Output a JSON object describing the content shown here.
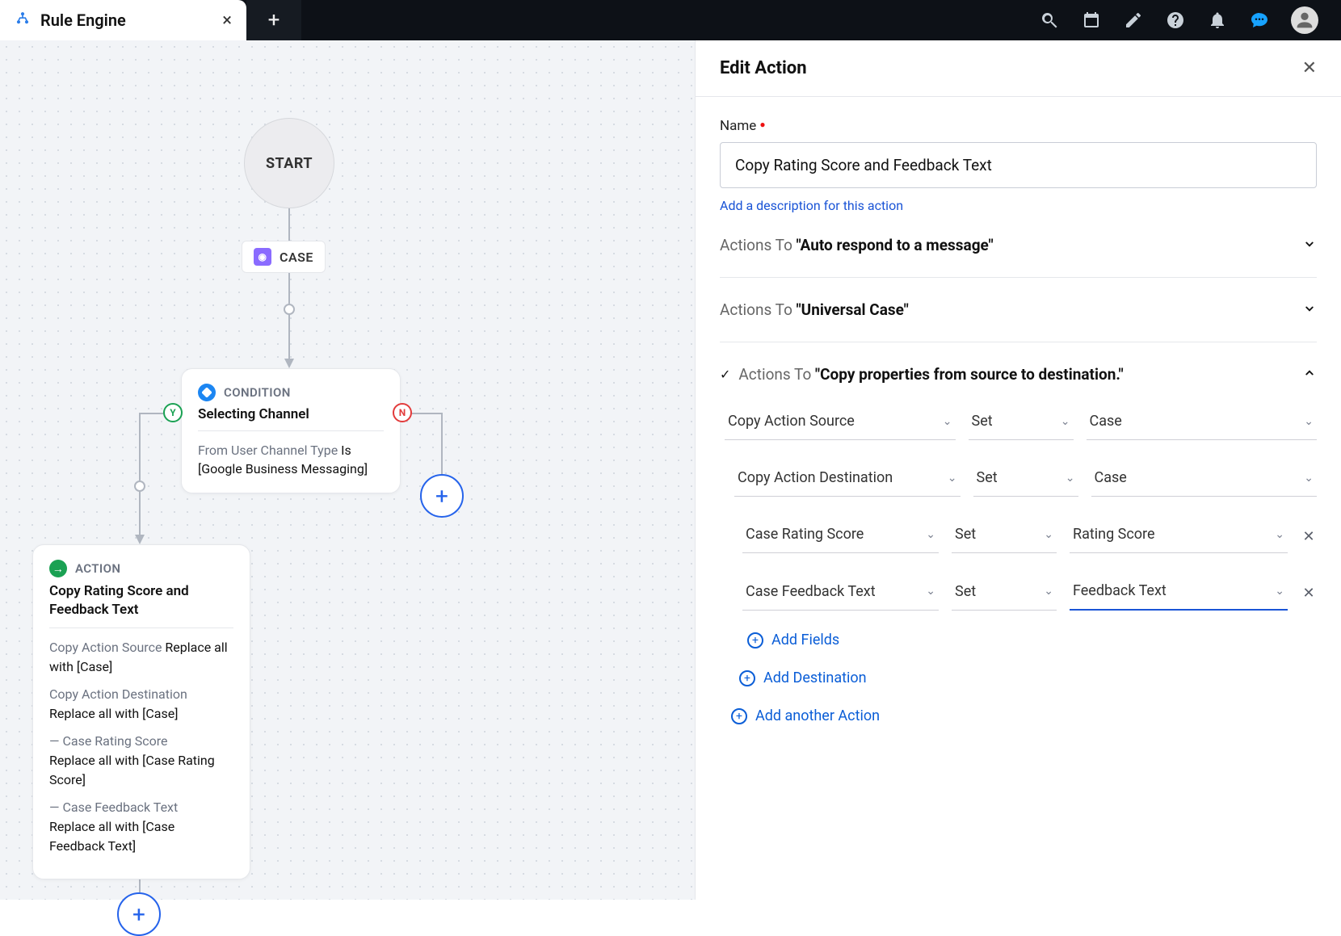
{
  "tab": {
    "title": "Rule Engine"
  },
  "canvas": {
    "start": "START",
    "case_chip": "CASE",
    "condition": {
      "label": "CONDITION",
      "title": "Selecting Channel",
      "text_prefix": "From User Channel Type ",
      "text_bold": "Is [Google Business Messaging]"
    },
    "action": {
      "label": "ACTION",
      "title": "Copy Rating Score and Feedback Text",
      "lines": [
        {
          "muted": "Copy Action Source ",
          "text": "Replace all with [Case]"
        },
        {
          "muted": "Copy Action Destination",
          "text": "Replace all with [Case]"
        },
        {
          "muted": "— Case Rating Score",
          "text": "Replace all with [Case Rating Score]"
        },
        {
          "muted": "— Case Feedback Text",
          "text": "Replace all with [Case Feedback Text]"
        }
      ]
    }
  },
  "panel": {
    "header": "Edit Action",
    "name_label": "Name",
    "name_value": "Copy Rating Score and Feedback Text",
    "desc_link": "Add a description for this action",
    "sections": [
      {
        "prefix": "Actions To ",
        "bold": "\"Auto respond to a message\"",
        "open": false
      },
      {
        "prefix": "Actions To ",
        "bold": "\"Universal Case\"",
        "open": false
      },
      {
        "prefix": "Actions To ",
        "bold": "\"Copy properties from source to destination.\"",
        "open": true,
        "checked": true
      }
    ],
    "rows": [
      {
        "key": "Copy Action Source",
        "op": "Set",
        "val": "Case"
      },
      {
        "key": "Copy Action Destination",
        "op": "Set",
        "val": "Case"
      },
      {
        "key": "Case Rating Score",
        "op": "Set",
        "val": "Rating Score",
        "removable": true,
        "centered": true
      },
      {
        "key": "Case Feedback Text",
        "op": "Set",
        "val": "Feedback Text",
        "removable": true,
        "centered": true,
        "active": true
      }
    ],
    "add_fields": "Add Fields",
    "add_destination": "Add Destination",
    "add_action": "Add another Action"
  }
}
